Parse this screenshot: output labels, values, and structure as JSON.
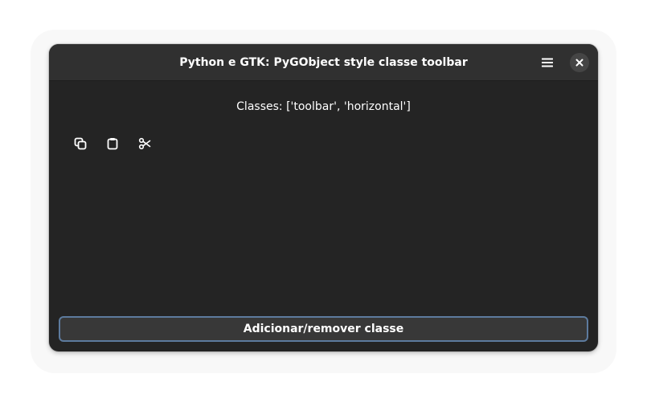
{
  "window": {
    "title": "Python e GTK: PyGObject style classe toolbar"
  },
  "header": {
    "menu_icon": "hamburger-menu-icon",
    "close_icon": "close-icon"
  },
  "content": {
    "classes_label": "Classes: ['toolbar', 'horizontal']",
    "toolbar": {
      "buttons": [
        {
          "icon": "copy-icon"
        },
        {
          "icon": "paste-icon"
        },
        {
          "icon": "cut-icon"
        }
      ]
    },
    "action_button_label": "Adicionar/remover classe"
  },
  "colors": {
    "window_bg": "#242424",
    "header_bg": "#303030",
    "button_bg": "#383838",
    "focus_border": "#5d7b9e",
    "text": "#ffffff"
  }
}
